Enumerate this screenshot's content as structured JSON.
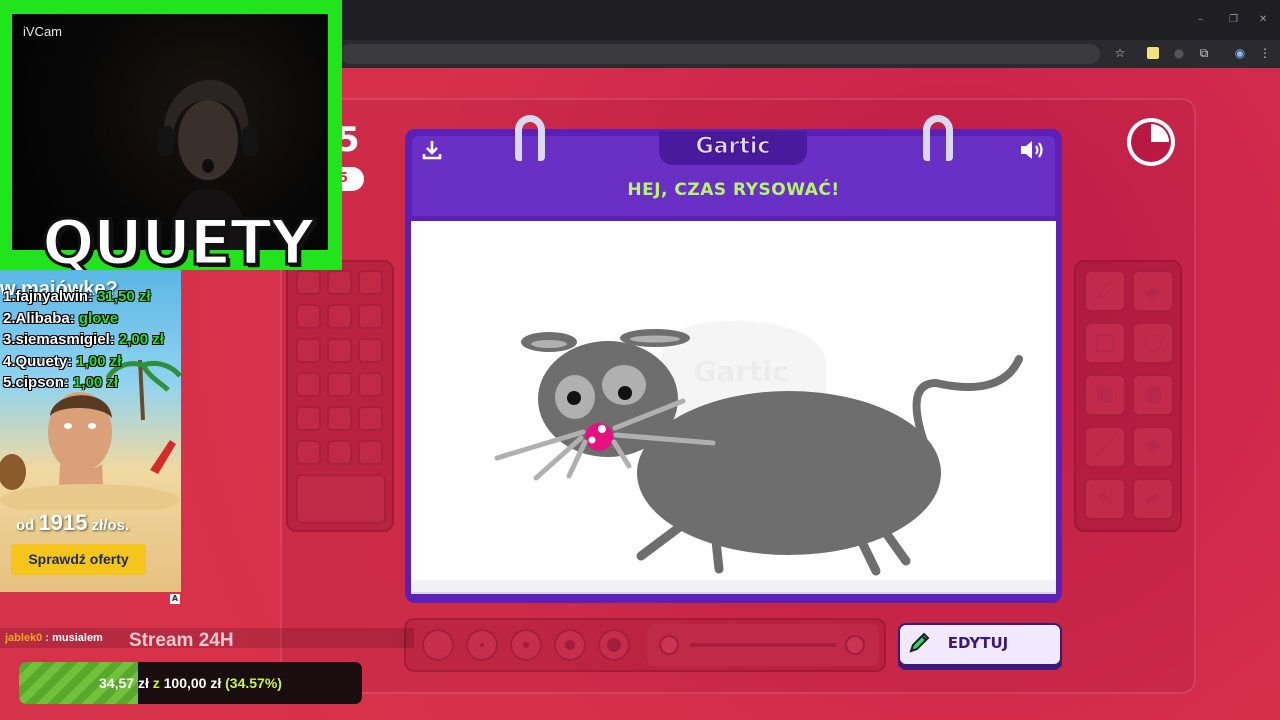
{
  "browser": {
    "window_controls": [
      "–",
      "❐",
      "✕"
    ],
    "toolbar_icons": [
      "star-icon",
      "extension-icon",
      "puzzle-icon",
      "profile-icon",
      "menu-icon"
    ]
  },
  "webcam": {
    "label": "iVCam",
    "streamer_name": "QUUETY",
    "border_color": "#22e41c"
  },
  "ad": {
    "headline": "w majówkę?",
    "price_prefix": "od",
    "price_value": "1915",
    "price_suffix": "zł/os.",
    "cta": "Sprawdź oferty",
    "badge": "A"
  },
  "leaderboard": [
    {
      "rank": "1.",
      "name": "fajnyalwin:",
      "amount": "31,50 zł"
    },
    {
      "rank": "2.",
      "name": "Alibaba:",
      "amount": "glove"
    },
    {
      "rank": "3.",
      "name": "siemasmigiel:",
      "amount": "2,00 zł"
    },
    {
      "rank": "4.",
      "name": "Quuety:",
      "amount": "1,00 zł"
    },
    {
      "rank": "5.",
      "name": "cipson:",
      "amount": "1,00 zł"
    }
  ],
  "chat": {
    "user": "jablek0",
    "separator": " : ",
    "message": "musialem"
  },
  "stream": {
    "title": "Stream 24H",
    "goal_current": "34,57 zł",
    "goal_connector": "z",
    "goal_target": "100,00 zł",
    "goal_percent_text": "(34.57%)",
    "goal_fraction": 0.3457
  },
  "round": {
    "number": "5",
    "pill": "5"
  },
  "board": {
    "brand": "Gartic",
    "title": "HEJ, CZAS RYSOWAĆ!",
    "watermark": "Gartic",
    "download_icon": "download-icon",
    "sound_icon": "speaker-icon",
    "accent": "#5b21b6",
    "title_color": "#b7f56b"
  },
  "tools": [
    "pencil-icon",
    "eraser-icon",
    "rectangle-outline-icon",
    "circle-outline-icon",
    "rectangle-filled-icon",
    "circle-filled-icon",
    "line-icon",
    "fill-bucket-icon",
    "undo-icon",
    "redo-icon"
  ],
  "controls": {
    "edit_label": "EDYTUJ",
    "edit_icon": "pencil-icon"
  },
  "timer": {
    "remaining_fraction": 0.75
  }
}
